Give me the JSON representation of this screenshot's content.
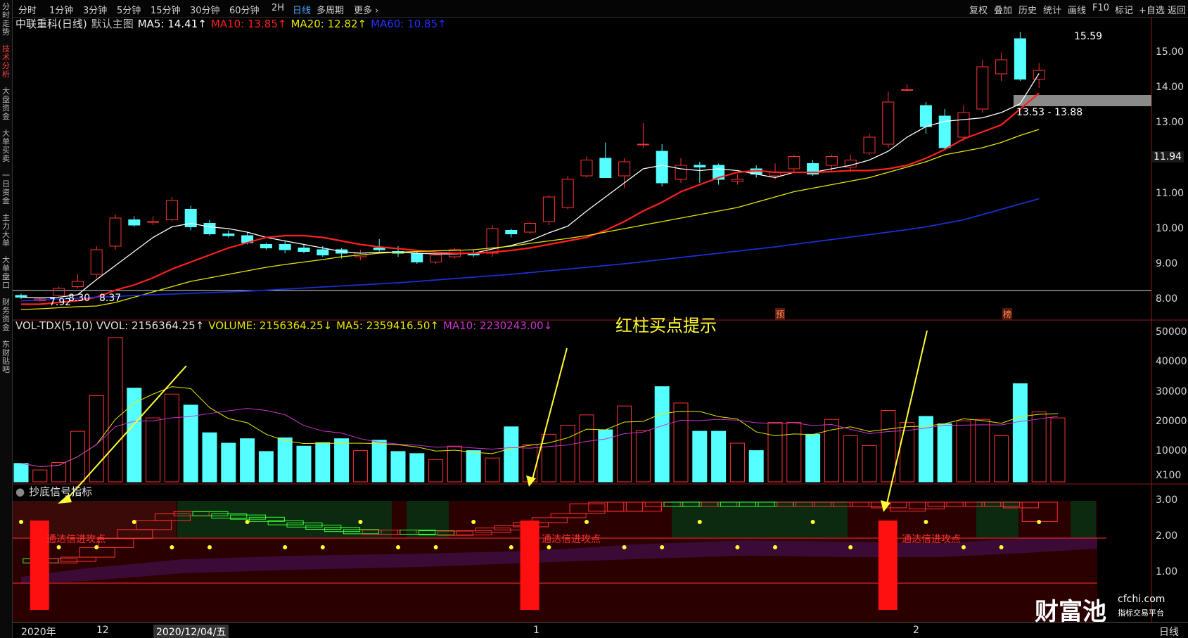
{
  "toolbar": {
    "left": [
      "分时",
      "1分钟",
      "3分钟",
      "5分钟",
      "15分钟",
      "30分钟",
      "60分钟",
      "2H",
      "日线",
      "多周期",
      "更多 ›"
    ],
    "right": [
      "复权",
      "叠加",
      "历史",
      "统计",
      "画线",
      "F10",
      "标记",
      "+自选",
      "返回"
    ],
    "active": "日线"
  },
  "side_tabs": [
    "分时走势",
    "技术分析",
    "大盘资金",
    "大单买卖",
    "一日资金",
    "主力大单",
    "大单盘口",
    "财务资金",
    "东财贴吧"
  ],
  "side_active": "技术分析",
  "main": {
    "stock": "中联重科(日线)",
    "template": "默认主图",
    "ma5": "MA5: 14.41↑",
    "ma10": "MA10: 13.85↑",
    "ma20": "MA20: 12.82↑",
    "ma60": "MA60: 10.85↑",
    "price_ticks": [
      "15.00",
      "14.00",
      "13.00",
      "12.00",
      "11.00",
      "10.00",
      "9.00",
      "8.00"
    ],
    "current_price": "11.94",
    "high_label": "15.59",
    "low_labels": [
      "7.92",
      "8.30",
      "8.37"
    ],
    "zone_label": "13.53 - 13.88",
    "event_markers": [
      "预",
      "榜"
    ]
  },
  "volume": {
    "title": "VOL-TDX(5,10) VVOL: 2156364.25↑",
    "volume": "VOLUME: 2156364.25↓",
    "ma5": "MA5: 2359416.50↑",
    "ma10": "MA10: 2230243.00↓",
    "ticks": [
      "50000",
      "40000",
      "30000",
      "20000",
      "10000",
      "X100"
    ]
  },
  "hint_text": "红柱买点提示",
  "indicator": {
    "title": "抄底信号指标",
    "ticks": [
      "3.00",
      "2.00",
      "1.00"
    ],
    "signal_text": "通达信进攻点"
  },
  "date_axis": [
    "2020年",
    "12",
    "2020/12/04/五",
    "1",
    "2"
  ],
  "period_label": "日线",
  "watermark": {
    "brand": "财富池",
    "site": "cfchi.com",
    "sub": "指标交易平台"
  },
  "colors": {
    "up": "#ff3232",
    "down": "#54ffff",
    "ma5": "#ffffff",
    "ma10": "#ff2020",
    "ma20": "#e6e600",
    "ma60": "#1a2fd0",
    "ma10vol": "#cc33cc",
    "arrow": "#ffff33"
  },
  "chart_data": {
    "type": "candlestick",
    "series": [
      {
        "name": "K",
        "ohlc": [
          [
            8.1,
            8.15,
            8.0,
            8.05
          ],
          [
            7.95,
            8.05,
            7.92,
            8.0
          ],
          [
            8.1,
            8.35,
            8.05,
            8.3
          ],
          [
            8.35,
            8.7,
            8.3,
            8.5
          ],
          [
            8.7,
            9.5,
            8.6,
            9.4
          ],
          [
            9.5,
            10.4,
            9.4,
            10.3
          ],
          [
            10.25,
            10.35,
            10.05,
            10.1
          ],
          [
            10.2,
            10.35,
            10.1,
            10.2
          ],
          [
            10.25,
            10.9,
            10.2,
            10.8
          ],
          [
            10.55,
            10.65,
            9.95,
            10.05
          ],
          [
            10.15,
            10.25,
            9.8,
            9.85
          ],
          [
            9.85,
            9.95,
            9.75,
            9.8
          ],
          [
            9.8,
            9.9,
            9.55,
            9.6
          ],
          [
            9.55,
            9.6,
            9.4,
            9.45
          ],
          [
            9.55,
            9.65,
            9.3,
            9.4
          ],
          [
            9.45,
            9.55,
            9.3,
            9.35
          ],
          [
            9.4,
            9.5,
            9.2,
            9.25
          ],
          [
            9.4,
            9.45,
            9.15,
            9.3
          ],
          [
            9.2,
            9.4,
            9.1,
            9.3
          ],
          [
            9.45,
            9.7,
            9.35,
            9.4
          ],
          [
            9.35,
            9.5,
            9.2,
            9.3
          ],
          [
            9.3,
            9.4,
            9.0,
            9.05
          ],
          [
            9.05,
            9.35,
            9.0,
            9.25
          ],
          [
            9.2,
            9.45,
            9.15,
            9.4
          ],
          [
            9.3,
            9.4,
            9.2,
            9.25
          ],
          [
            9.3,
            10.1,
            9.2,
            10.0
          ],
          [
            9.95,
            10.0,
            9.75,
            9.85
          ],
          [
            9.9,
            10.2,
            9.85,
            10.15
          ],
          [
            10.2,
            10.95,
            10.1,
            10.9
          ],
          [
            10.6,
            11.5,
            10.55,
            11.4
          ],
          [
            11.5,
            12.05,
            11.45,
            11.95
          ],
          [
            12.0,
            12.45,
            11.95,
            11.45
          ],
          [
            11.5,
            12.0,
            11.15,
            11.9
          ],
          [
            12.4,
            13.0,
            12.3,
            12.4
          ],
          [
            12.2,
            12.4,
            11.2,
            11.3
          ],
          [
            11.4,
            12.0,
            11.3,
            11.8
          ],
          [
            11.8,
            11.9,
            11.3,
            11.75
          ],
          [
            11.8,
            11.85,
            11.25,
            11.4
          ],
          [
            11.35,
            11.55,
            11.25,
            11.4
          ],
          [
            11.7,
            11.8,
            11.45,
            11.55
          ],
          [
            11.5,
            11.85,
            11.4,
            11.6
          ],
          [
            11.7,
            12.1,
            11.6,
            12.05
          ],
          [
            11.85,
            11.95,
            11.5,
            11.55
          ],
          [
            11.8,
            12.1,
            11.6,
            12.05
          ],
          [
            11.75,
            12.1,
            11.6,
            11.95
          ],
          [
            12.15,
            12.7,
            12.1,
            12.6
          ],
          [
            12.4,
            13.9,
            12.3,
            13.6
          ],
          [
            13.95,
            14.1,
            13.9,
            13.95
          ],
          [
            13.5,
            13.6,
            12.7,
            12.9
          ],
          [
            13.2,
            13.4,
            12.25,
            12.3
          ],
          [
            12.6,
            13.5,
            12.5,
            13.3
          ],
          [
            13.4,
            14.8,
            13.3,
            14.6
          ],
          [
            14.4,
            15.0,
            14.2,
            14.8
          ],
          [
            15.4,
            15.59,
            14.2,
            14.25
          ],
          [
            14.25,
            14.7,
            14.0,
            14.5
          ]
        ]
      },
      {
        "name": "MA5",
        "values": [
          8.05,
          8.03,
          8.05,
          8.12,
          8.55,
          8.95,
          9.35,
          9.75,
          10.05,
          10.15,
          10.05,
          10.0,
          9.9,
          9.75,
          9.65,
          9.55,
          9.45,
          9.35,
          9.3,
          9.33,
          9.33,
          9.3,
          9.28,
          9.28,
          9.3,
          9.42,
          9.52,
          9.66,
          9.88,
          10.07,
          10.5,
          10.9,
          11.3,
          11.7,
          11.8,
          11.7,
          11.65,
          11.7,
          11.65,
          11.55,
          11.45,
          11.6,
          11.6,
          11.7,
          11.8,
          11.95,
          12.2,
          12.6,
          12.9,
          13.05,
          13.1,
          13.15,
          13.3,
          13.55,
          14.41
        ]
      },
      {
        "name": "MA10",
        "values": [
          7.85,
          7.85,
          7.9,
          7.95,
          8.05,
          8.25,
          8.4,
          8.6,
          8.85,
          9.05,
          9.25,
          9.45,
          9.6,
          9.75,
          9.8,
          9.8,
          9.75,
          9.65,
          9.55,
          9.48,
          9.43,
          9.38,
          9.33,
          9.3,
          9.3,
          9.33,
          9.38,
          9.45,
          9.55,
          9.65,
          9.75,
          9.95,
          10.2,
          10.5,
          10.75,
          11.05,
          11.25,
          11.45,
          11.6,
          11.65,
          11.6,
          11.6,
          11.6,
          11.62,
          11.65,
          11.65,
          11.7,
          11.8,
          12.0,
          12.25,
          12.55,
          12.75,
          12.95,
          13.4,
          13.85
        ]
      },
      {
        "name": "MA20",
        "values": [
          7.7,
          7.72,
          7.75,
          7.78,
          7.8,
          7.9,
          8.05,
          8.2,
          8.35,
          8.5,
          8.6,
          8.7,
          8.8,
          8.9,
          8.98,
          9.05,
          9.12,
          9.2,
          9.25,
          9.3,
          9.33,
          9.35,
          9.37,
          9.38,
          9.4,
          9.45,
          9.5,
          9.58,
          9.65,
          9.72,
          9.8,
          9.9,
          10.0,
          10.1,
          10.2,
          10.3,
          10.4,
          10.5,
          10.6,
          10.75,
          10.9,
          11.05,
          11.15,
          11.25,
          11.35,
          11.45,
          11.6,
          11.75,
          11.9,
          12.1,
          12.2,
          12.3,
          12.45,
          12.65,
          12.82
        ]
      },
      {
        "name": "MA60",
        "values": [
          7.95,
          7.97,
          8.0,
          8.02,
          8.05,
          8.07,
          8.1,
          8.12,
          8.14,
          8.16,
          8.18,
          8.2,
          8.22,
          8.25,
          8.28,
          8.31,
          8.34,
          8.37,
          8.4,
          8.43,
          8.46,
          8.5,
          8.54,
          8.58,
          8.62,
          8.66,
          8.7,
          8.75,
          8.8,
          8.85,
          8.9,
          8.95,
          9.0,
          9.06,
          9.12,
          9.18,
          9.24,
          9.3,
          9.36,
          9.42,
          9.48,
          9.55,
          9.62,
          9.69,
          9.76,
          9.83,
          9.9,
          9.97,
          10.05,
          10.15,
          10.25,
          10.4,
          10.55,
          10.7,
          10.85
        ]
      },
      {
        "name": "VOLUME",
        "values": [
          6200,
          4000,
          6500,
          17000,
          29000,
          48500,
          31500,
          21500,
          29500,
          25800,
          16500,
          13000,
          14500,
          10200,
          14800,
          12000,
          13200,
          14500,
          10500,
          14000,
          10200,
          9500,
          7500,
          12000,
          10500,
          8000,
          18500,
          12500,
          16000,
          19000,
          22500,
          17500,
          25500,
          17200,
          32000,
          26500,
          17000,
          17000,
          13000,
          10500,
          20000,
          20000,
          16000,
          21000,
          15500,
          12200,
          24000,
          20000,
          22000,
          19500,
          20500,
          21000,
          15500,
          33000,
          23500,
          21500
        ]
      }
    ],
    "ylim": [
      7.7,
      15.9
    ],
    "volume_ylim": [
      0,
      52000
    ],
    "indicator_ylim": [
      0,
      3.2
    ],
    "signals": [
      1,
      27,
      46
    ]
  }
}
